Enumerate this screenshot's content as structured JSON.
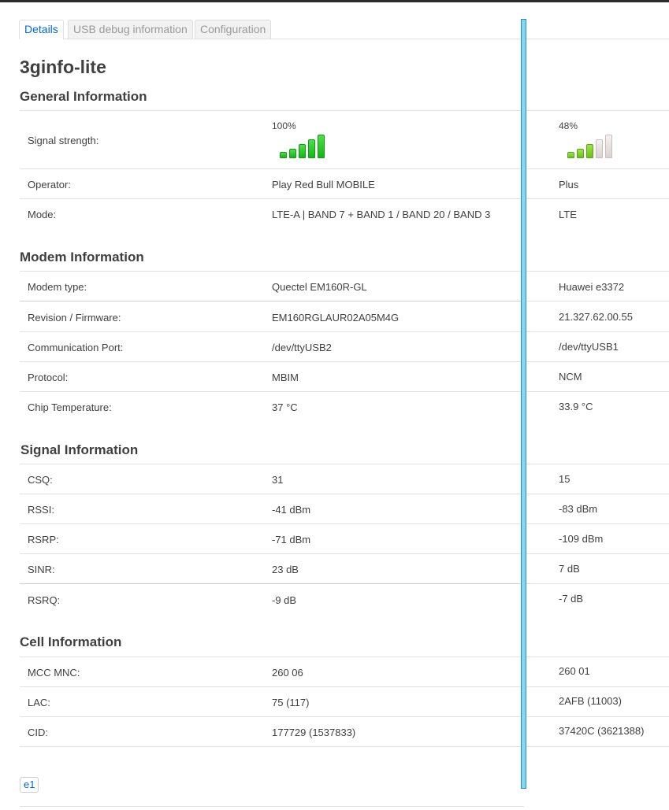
{
  "tabs": [
    "Details",
    "USB debug information",
    "Configuration"
  ],
  "page_title": "3ginfo-lite",
  "sections": {
    "general": "General Information",
    "modem": "Modem Information",
    "signal": "Signal Information",
    "cell": "Cell Information"
  },
  "general": {
    "signal_label": "Signal strength:",
    "signal_1": "100%",
    "signal_2": "48%",
    "signal_level_1": 5,
    "signal_level_2": 3,
    "operator_label": "Operator:",
    "operator_1": "Play Red Bull MOBILE",
    "operator_2": "Plus",
    "mode_label": "Mode:",
    "mode_1": "LTE-A | BAND 7 + BAND 1 / BAND 20 / BAND 3",
    "mode_2": "LTE"
  },
  "modem": {
    "type_label": "Modem type:",
    "type_1": "Quectel EM160R-GL",
    "type_2": "Huawei e3372",
    "rev_label": "Revision / Firmware:",
    "rev_1": "EM160RGLAUR02A05M4G",
    "rev_2": "21.327.62.00.55",
    "port_label": "Communication Port:",
    "port_1": "/dev/ttyUSB2",
    "port_2": "/dev/ttyUSB1",
    "proto_label": "Protocol:",
    "proto_1": "MBIM",
    "proto_2": "NCM",
    "temp_label": "Chip Temperature:",
    "temp_1": "37 °C",
    "temp_2": "33.9 °C"
  },
  "signal": {
    "csq_label": "CSQ:",
    "csq_1": "31",
    "csq_2": "15",
    "rssi_label": "RSSI:",
    "rssi_1": "-41 dBm",
    "rssi_2": "-83 dBm",
    "rsrp_label": "RSRP:",
    "rsrp_1": "-71 dBm",
    "rsrp_2": "-109 dBm",
    "sinr_label": "SINR:",
    "sinr_1": "23 dB",
    "sinr_2": "7 dB",
    "rsrq_label": "RSRQ:",
    "rsrq_1": "-9 dB",
    "rsrq_2": "-7 dB"
  },
  "cell": {
    "mcc_label": "MCC MNC:",
    "mcc_1": "260 06",
    "mcc_2": "260 01",
    "lac_label": "LAC:",
    "lac_1": "75 (117)",
    "lac_2": "2AFB (11003)",
    "cid_label": "CID:",
    "cid_1": "177729 (1537833)",
    "cid_2": "37420C (3621388)"
  },
  "footer_button": "e1",
  "colors": {
    "accent": "#0069d6",
    "divider": "#87d6ef",
    "bar_green": "#16b516",
    "bar_lime": "#66c21a"
  }
}
